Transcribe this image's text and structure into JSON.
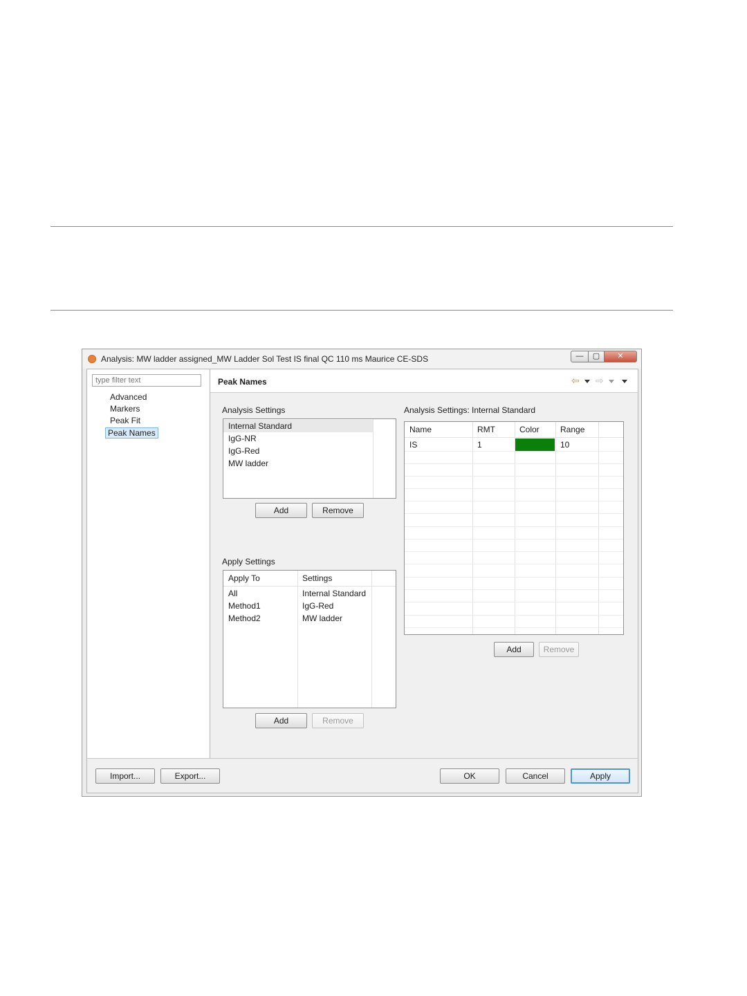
{
  "window": {
    "title": "Analysis: MW ladder assigned_MW Ladder Sol Test IS final QC 110 ms Maurice CE-SDS",
    "controls": {
      "minimize": "—",
      "maximize": "▢",
      "close": "✕"
    }
  },
  "sidebar": {
    "filter_placeholder": "type filter text",
    "items": [
      {
        "label": "Advanced"
      },
      {
        "label": "Markers"
      },
      {
        "label": "Peak Fit"
      },
      {
        "label": "Peak Names",
        "selected": true
      }
    ]
  },
  "panel": {
    "title": "Peak Names",
    "icons": {
      "back": "back-arrow-icon",
      "forward": "forward-arrow-icon",
      "menu": "dropdown-menu-icon"
    }
  },
  "analysis_settings": {
    "label": "Analysis Settings",
    "items": [
      "Internal Standard",
      "IgG-NR",
      "IgG-Red",
      "MW ladder"
    ],
    "selected_index": 0,
    "add_label": "Add",
    "remove_label": "Remove"
  },
  "apply_settings": {
    "label": "Apply Settings",
    "columns": [
      "Apply To",
      "Settings"
    ],
    "rows": [
      [
        "All",
        "Internal Standard"
      ],
      [
        "Method1",
        "IgG-Red"
      ],
      [
        "Method2",
        "MW ladder"
      ]
    ],
    "add_label": "Add",
    "remove_label": "Remove"
  },
  "internal_standard": {
    "label": "Analysis Settings: Internal Standard",
    "columns": [
      "Name",
      "RMT",
      "Color",
      "Range"
    ],
    "rows": [
      {
        "name": "IS",
        "rmt": "1",
        "color": "#0a7f0a",
        "range": "10"
      }
    ],
    "add_label": "Add",
    "remove_label": "Remove"
  },
  "footer": {
    "import_label": "Import...",
    "export_label": "Export...",
    "ok_label": "OK",
    "cancel_label": "Cancel",
    "apply_label": "Apply"
  }
}
